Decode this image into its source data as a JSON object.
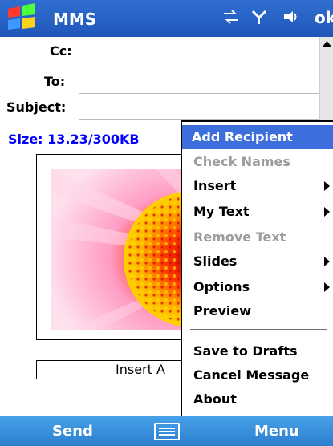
{
  "title_bar": {
    "app_title": "MMS",
    "status_icons": [
      "windows-flag-icon",
      "sync-icon",
      "signal-icon",
      "volume-icon"
    ],
    "ok_label": "ok"
  },
  "form": {
    "cc_label": "Cc:",
    "to_label": "To:",
    "subject_label": "Subject:"
  },
  "size_text": "Size: 13.23/300KB",
  "slide": {
    "insert_text_placeholder": "Insert A"
  },
  "menu": {
    "items": [
      {
        "label": "Add Recipient",
        "state": "selected"
      },
      {
        "label": "Check Names",
        "state": "disabled"
      },
      {
        "label": "Insert",
        "state": "enabled",
        "submenu": true
      },
      {
        "label": "My Text",
        "state": "enabled",
        "submenu": true
      },
      {
        "label": "Remove Text",
        "state": "disabled"
      },
      {
        "label": "Slides",
        "state": "enabled",
        "submenu": true
      },
      {
        "label": "Options",
        "state": "enabled",
        "submenu": true
      },
      {
        "label": "Preview",
        "state": "enabled"
      },
      {
        "label": "Save to Drafts",
        "state": "enabled"
      },
      {
        "label": "Cancel Message",
        "state": "enabled"
      },
      {
        "label": "About",
        "state": "enabled"
      }
    ]
  },
  "bottom_bar": {
    "left": "Send",
    "right": "Menu",
    "keyboard_icon": "keyboard-icon"
  },
  "colors": {
    "title_bar": "#1f56b8",
    "selected_menu": "#3d6fdc",
    "size_text": "#0000ff",
    "bottom_bar": "#2b7fcd"
  }
}
